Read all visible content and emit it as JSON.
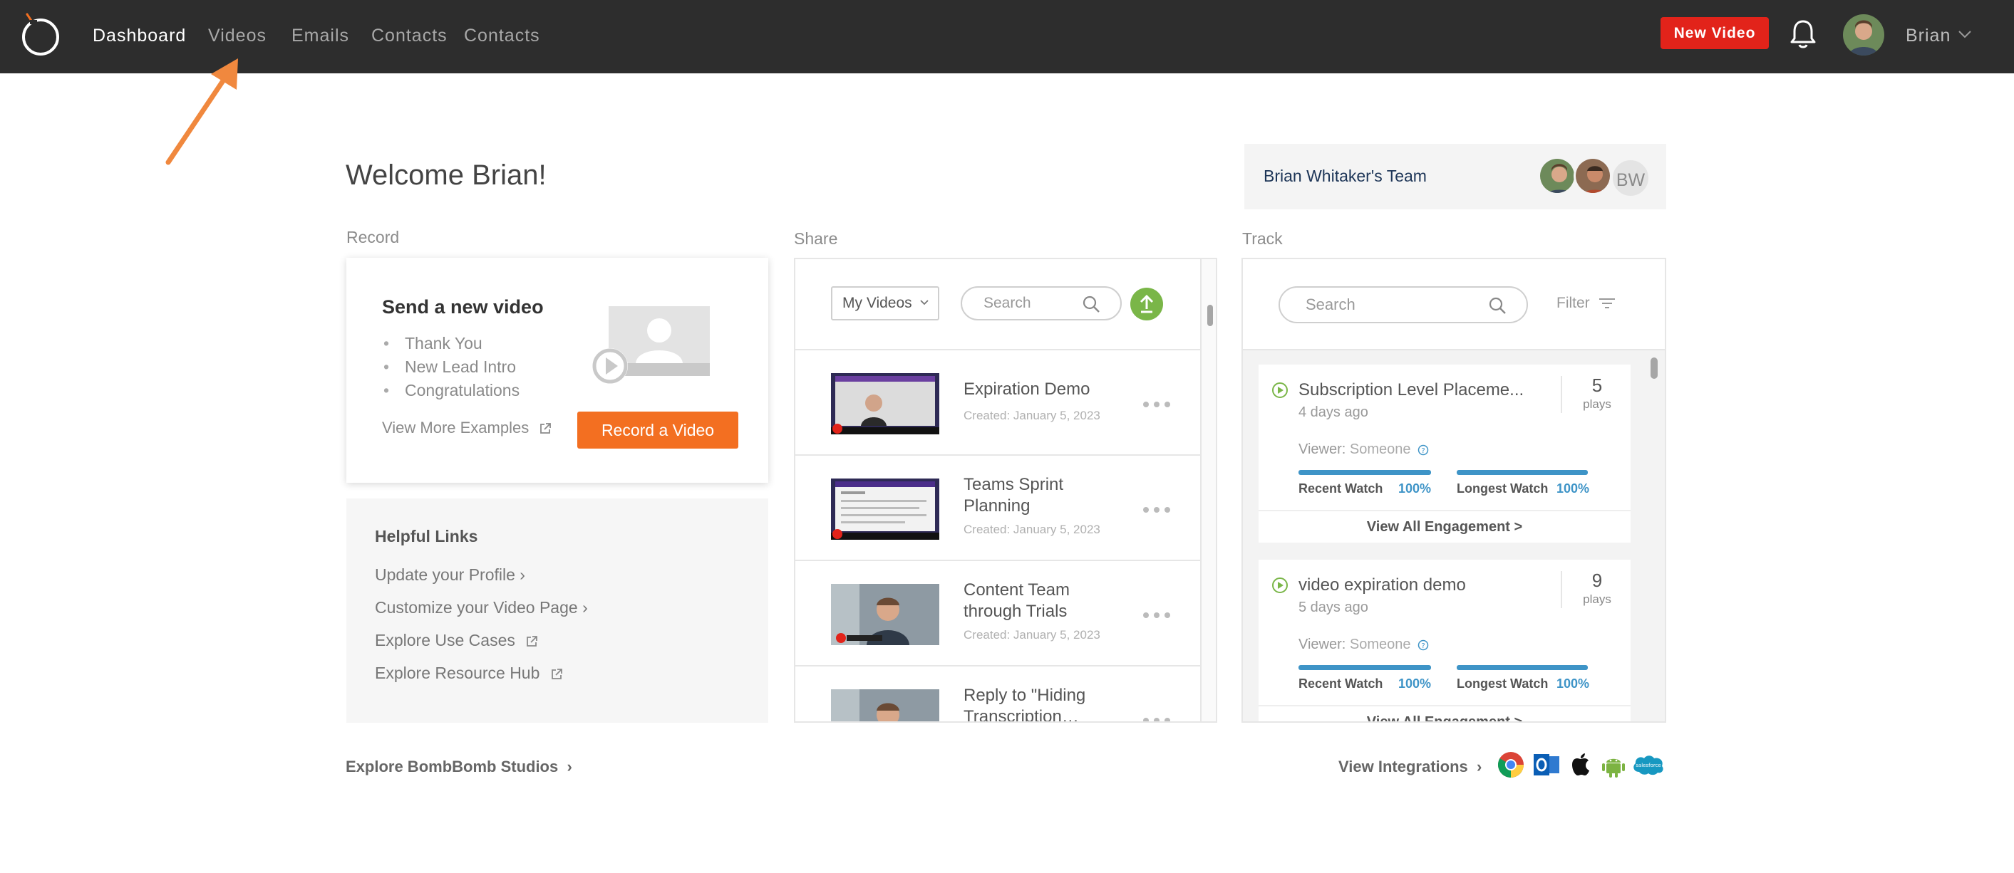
{
  "nav": {
    "items": [
      "Dashboard",
      "Videos",
      "Emails",
      "Contacts",
      "Contacts"
    ],
    "active_index": 0,
    "new_video_label": "New Video",
    "user_name": "Brian"
  },
  "welcome": "Welcome Brian!",
  "team": {
    "name": "Brian Whitaker's Team",
    "initials": "BW"
  },
  "record": {
    "section_label": "Record",
    "title": "Send a new video",
    "examples": [
      "Thank You",
      "New Lead Intro",
      "Congratulations"
    ],
    "view_more": "View More Examples",
    "button": "Record a Video"
  },
  "helpful": {
    "title": "Helpful Links",
    "links": [
      "Update your Profile",
      "Customize your Video Page",
      "Explore Use Cases",
      "Explore Resource Hub"
    ]
  },
  "share": {
    "section_label": "Share",
    "select_value": "My Videos",
    "search_placeholder": "Search",
    "videos": [
      {
        "title": "Expiration Demo",
        "date": "Created: January 5, 2023"
      },
      {
        "title": "Teams Sprint Planning",
        "date": "Created: January 5, 2023"
      },
      {
        "title": "Content Team through Trials",
        "date": "Created: January 5, 2023"
      },
      {
        "title": "Reply to \"Hiding Transcription…",
        "date": ""
      }
    ]
  },
  "track": {
    "section_label": "Track",
    "search_placeholder": "Search",
    "filter_label": "Filter",
    "items": [
      {
        "title": "Subscription Level Placeme...",
        "time": "4 days ago",
        "count": "5",
        "plays_label": "plays",
        "viewer_label": "Viewer:",
        "viewer": "Someone",
        "recent_label": "Recent Watch",
        "recent_pct": "100%",
        "longest_label": "Longest Watch",
        "longest_pct": "100%",
        "footer": "View All Engagement >"
      },
      {
        "title": "video expiration demo",
        "time": "5 days ago",
        "count": "9",
        "plays_label": "plays",
        "viewer_label": "Viewer:",
        "viewer": "Someone",
        "recent_label": "Recent Watch",
        "recent_pct": "100%",
        "longest_label": "Longest Watch",
        "longest_pct": "100%",
        "footer": "View All Engagement >"
      }
    ]
  },
  "bottom": {
    "explore_studios": "Explore BombBomb Studios",
    "view_integrations": "View Integrations",
    "integration_icons": [
      "chrome-icon",
      "outlook-icon",
      "apple-icon",
      "android-icon",
      "salesforce-icon"
    ]
  },
  "colors": {
    "topbar": "#2d2d2d",
    "new_video": "#e2231a",
    "record_button": "#f36f21",
    "upload": "#7ab648",
    "progress": "#3e94c7",
    "arrow": "#f0883e"
  }
}
